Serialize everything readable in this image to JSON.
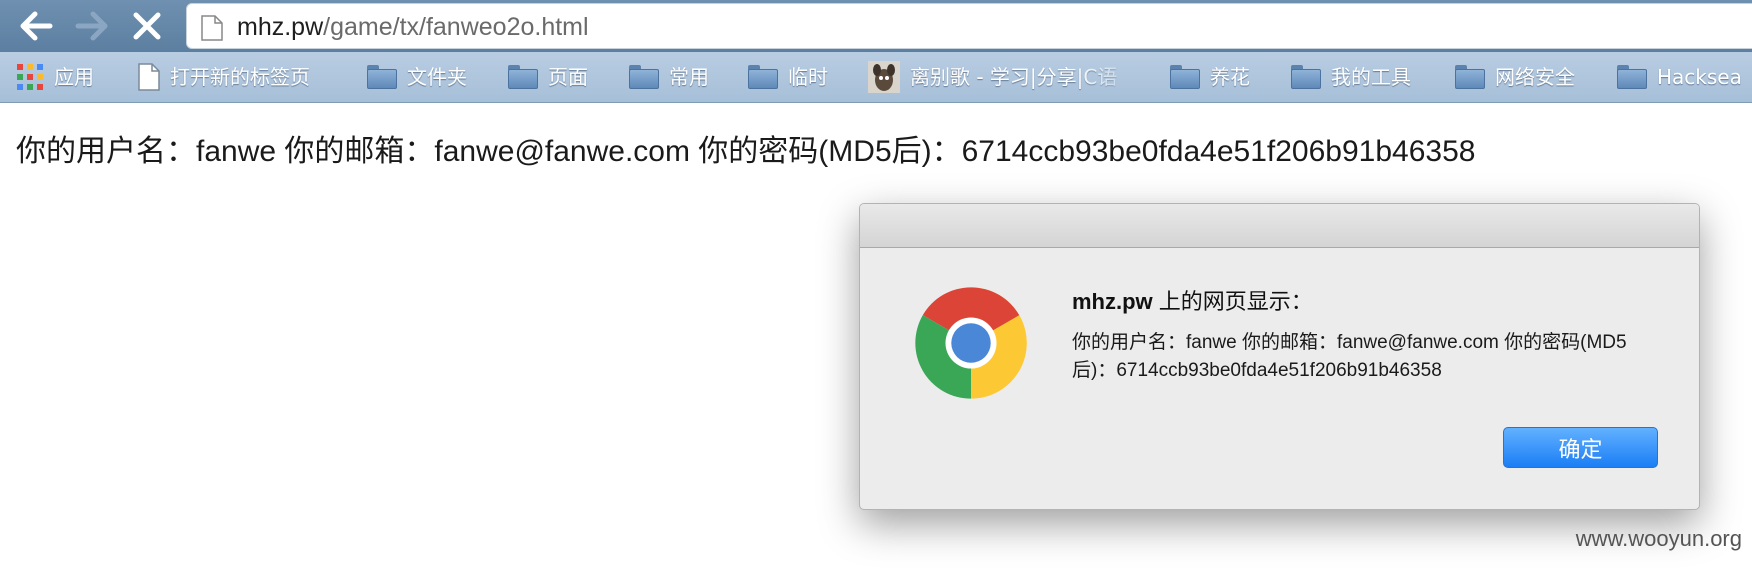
{
  "toolbar": {
    "back_icon": "back-arrow-icon",
    "forward_icon": "forward-arrow-icon",
    "stop_icon": "close-icon",
    "url_host": "mhz.pw",
    "url_path": "/game/tx/fanweo2o.html"
  },
  "bookmarks": [
    {
      "icon": "apps-grid-icon",
      "label": "应用"
    },
    {
      "icon": "page-icon",
      "label": "打开新的标签页"
    },
    {
      "icon": "folder-icon",
      "label": "文件夹"
    },
    {
      "icon": "folder-icon",
      "label": "页面"
    },
    {
      "icon": "folder-icon",
      "label": "常用"
    },
    {
      "icon": "folder-icon",
      "label": "临时"
    },
    {
      "icon": "avatar-icon",
      "label": "离别歌 - 学习|分享|C语"
    },
    {
      "icon": "folder-icon",
      "label": "养花"
    },
    {
      "icon": "folder-icon",
      "label": "我的工具"
    },
    {
      "icon": "folder-icon",
      "label": "网络安全"
    },
    {
      "icon": "folder-icon",
      "label": "Hacksea"
    }
  ],
  "page": {
    "text": "你的用户名：fanwe 你的邮箱：fanwe@fanwe.com 你的密码(MD5后)：6714ccb93be0fda4e51f206b91b46358"
  },
  "dialog": {
    "heading_host": "mhz.pw",
    "heading_suffix": " 上的网页显示：",
    "message": "你的用户名：fanwe 你的邮箱：fanwe@fanwe.com 你的密码(MD5后)：6714ccb93be0fda4e51f206b91b46358",
    "ok_label": "确定",
    "logo_icon": "chrome-logo-icon"
  },
  "watermark": "www.wooyun.org",
  "colors": {
    "toolbar": "#6385a7",
    "bookmarks_bar": "#b0c7de",
    "ok_button": "#1b7ef5"
  }
}
